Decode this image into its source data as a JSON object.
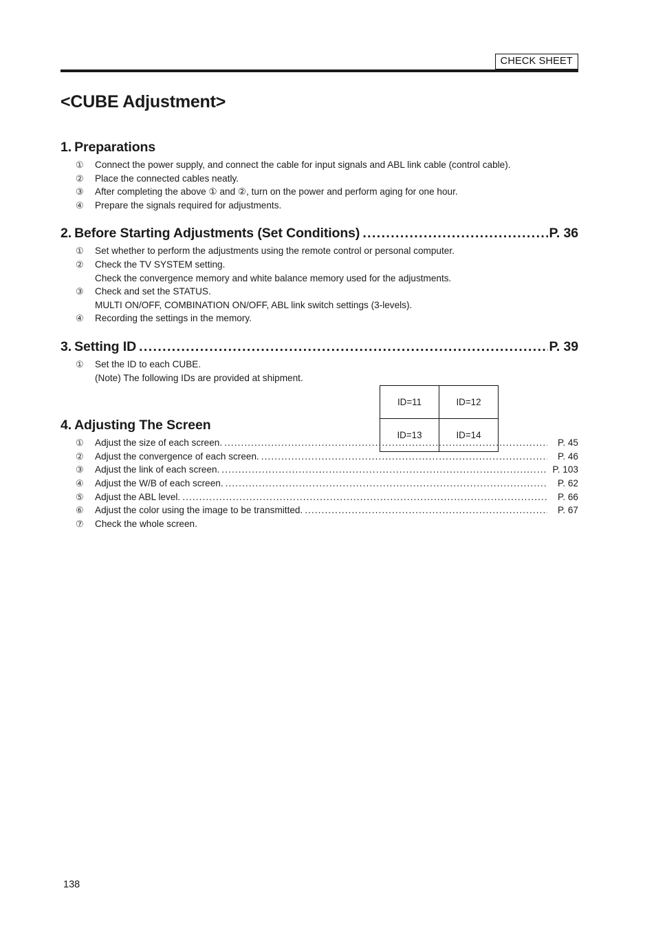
{
  "header": {
    "badge": "CHECK SHEET"
  },
  "title": "<CUBE Adjustment>",
  "sections": [
    {
      "number": "1.",
      "title": "Preparations",
      "page": "",
      "items": [
        {
          "mark": "①",
          "text": "Connect the power supply, and connect the cable for input signals and ABL link cable (control cable).",
          "page": ""
        },
        {
          "mark": "②",
          "text": "Place the connected cables neatly.",
          "page": ""
        },
        {
          "mark": "③",
          "text": "After completing the above ① and ②, turn on the power and perform aging for one hour.",
          "page": ""
        },
        {
          "mark": "④",
          "text": "Prepare the signals required for adjustments.",
          "page": ""
        }
      ]
    },
    {
      "number": "2.",
      "title": "Before Starting Adjustments (Set Conditions)",
      "page": "P. 36",
      "items": [
        {
          "mark": "①",
          "text": "Set whether to perform the adjustments using the remote control or personal computer.",
          "page": ""
        },
        {
          "mark": "②",
          "text": "Check the TV SYSTEM setting.",
          "page": "",
          "sub": "Check the convergence memory and white balance memory used for the adjustments."
        },
        {
          "mark": "③",
          "text": "Check and set the STATUS.",
          "page": "",
          "sub": "MULTI ON/OFF, COMBINATION ON/OFF, ABL link switch settings (3-levels)."
        },
        {
          "mark": "④",
          "text": "Recording the settings in the memory.",
          "page": ""
        }
      ]
    },
    {
      "number": "3.",
      "title": "Setting ID",
      "page": "P. 39",
      "items": [
        {
          "mark": "①",
          "text": "Set the ID to each CUBE.",
          "page": "",
          "sub": "(Note) The following IDs are provided at shipment."
        }
      ]
    },
    {
      "number": "4.",
      "title": "Adjusting The Screen",
      "page": "",
      "items": [
        {
          "mark": "①",
          "text": "Adjust the size of each screen.",
          "page": "P. 45"
        },
        {
          "mark": "②",
          "text": "Adjust the convergence of each screen.",
          "page": "P. 46"
        },
        {
          "mark": "③",
          "text": "Adjust the link of each screen.",
          "page": "P. 103"
        },
        {
          "mark": "④",
          "text": "Adjust the W/B of each screen.",
          "page": "P. 62"
        },
        {
          "mark": "⑤",
          "text": "Adjust the ABL level.",
          "page": "P. 66"
        },
        {
          "mark": "⑥",
          "text": "Adjust the color using the image to be transmitted.",
          "page": "P. 67"
        },
        {
          "mark": "⑦",
          "text": "Check the whole screen.",
          "page": ""
        }
      ]
    }
  ],
  "id_table": {
    "rows": [
      [
        "ID=11",
        "ID=12"
      ],
      [
        "ID=13",
        "ID=14"
      ]
    ]
  },
  "footer": {
    "page_number": "138"
  },
  "leaders": {
    "heading_dots": "..............................................................................................................",
    "item_dots": "................................................................................................................................................"
  }
}
